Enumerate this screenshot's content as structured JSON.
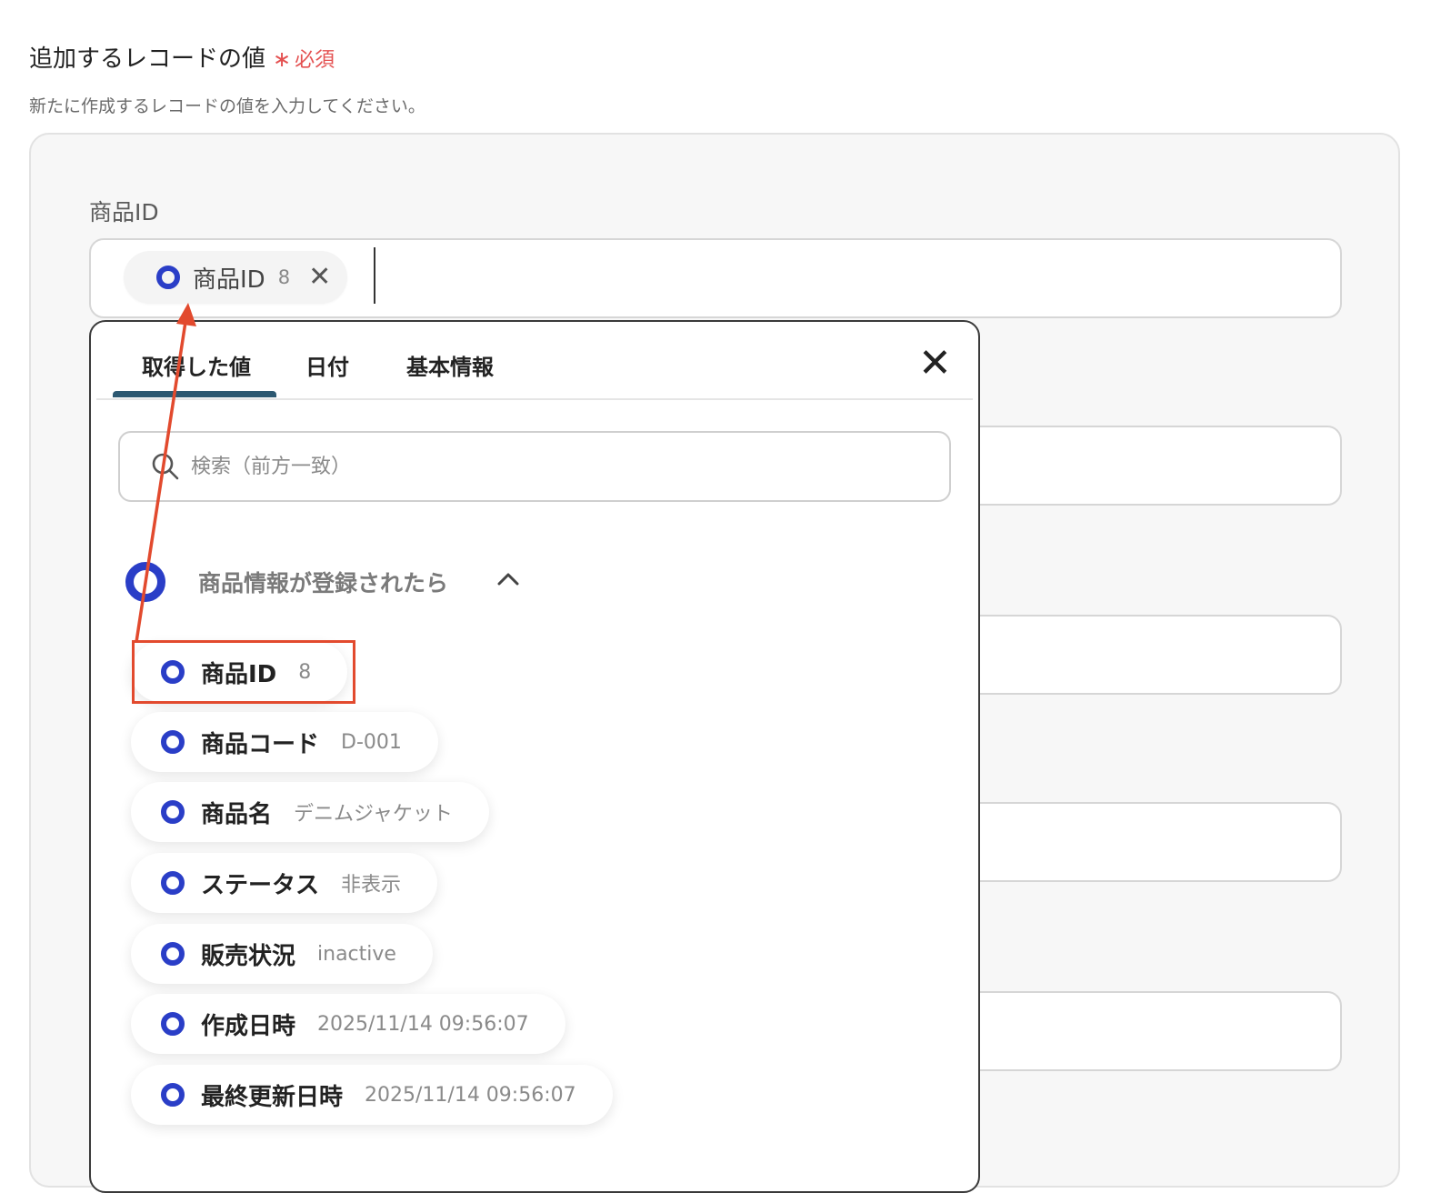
{
  "header": {
    "title": "追加するレコードの値",
    "required_mark": "∗",
    "required_text": "必須",
    "description": "新たに作成するレコードの値を入力してください。"
  },
  "field": {
    "label": "商品ID",
    "chip": {
      "label": "商品ID",
      "value": "8",
      "close": "✕"
    }
  },
  "dropdown": {
    "tabs": [
      "取得した値",
      "日付",
      "基本情報"
    ],
    "active_tab": "取得した値",
    "close": "✕",
    "search_placeholder": "検索（前方一致）",
    "group": {
      "title": "商品情報が登録されたら",
      "chevron": "︿"
    },
    "options": [
      {
        "label": "商品ID",
        "value": "8"
      },
      {
        "label": "商品コード",
        "value": "D-001"
      },
      {
        "label": "商品名",
        "value": "デニムジャケット"
      },
      {
        "label": "ステータス",
        "value": "非表示"
      },
      {
        "label": "販売状況",
        "value": "inactive"
      },
      {
        "label": "作成日時",
        "value": "2025/11/14 09:56:07"
      },
      {
        "label": "最終更新日時",
        "value": "2025/11/14 09:56:07"
      }
    ]
  },
  "colors": {
    "accent_ring": "#2a3ec7",
    "required": "#e45151",
    "annotation": "#e24a2e",
    "tab_underline": "#2c5871"
  },
  "icons": {
    "item": "ring-icon",
    "search": "search-icon",
    "close": "close-icon",
    "chevron": "chevron-up-icon"
  }
}
